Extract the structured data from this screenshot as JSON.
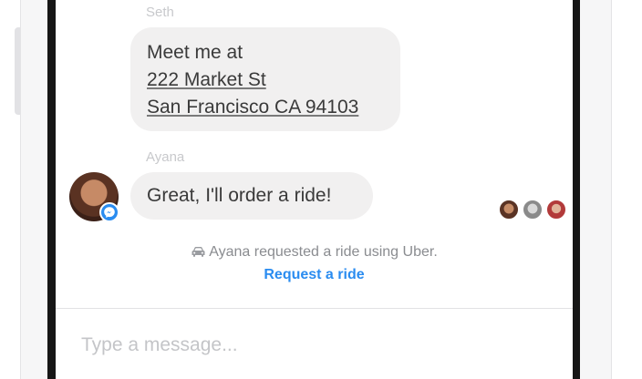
{
  "conversation": {
    "messages": [
      {
        "sender": "Seth",
        "lines": [
          "Meet me at",
          "222 Market St",
          "San Francisco CA 94103"
        ]
      },
      {
        "sender": "Ayana",
        "lines": [
          "Great, I'll order a ride!"
        ]
      }
    ]
  },
  "system_note": {
    "icon": "car-icon",
    "text": "Ayana requested a ride using Uber.",
    "action_label": "Request a ride"
  },
  "composer": {
    "placeholder": "Type a message..."
  },
  "colors": {
    "bubble": "#f1f0f0",
    "accent": "#2a8cf0",
    "muted_text": "#c8c9cc"
  }
}
